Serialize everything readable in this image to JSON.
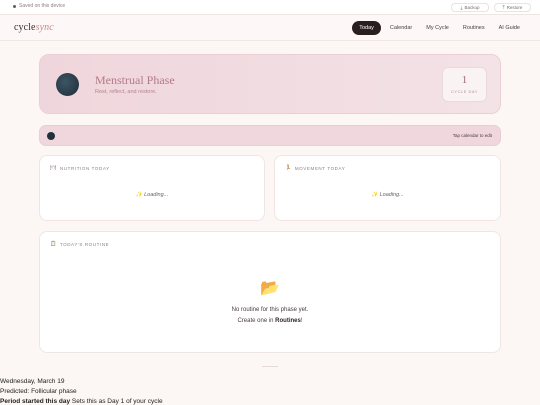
{
  "topbar": {
    "saved_label": "Saved on this device",
    "backup_label": "Backup",
    "restore_label": "Restore"
  },
  "header": {
    "logo_cycle": "cycle",
    "logo_sync": "sync",
    "nav": [
      {
        "label": "Today",
        "active": true
      },
      {
        "label": "Calendar"
      },
      {
        "label": "My Cycle"
      },
      {
        "label": "Routines"
      },
      {
        "label": "AI Guide"
      }
    ]
  },
  "phase": {
    "title": "Menstrual Phase",
    "subtitle": "Rest, reflect, and restore.",
    "cycle_day": "1",
    "cycle_day_label": "CYCLE DAY"
  },
  "strip": {
    "hint": "Tap calendar to edit"
  },
  "nutrition": {
    "icon": "🍽",
    "title": "NUTRITION TODAY",
    "status": "✨ Loading..."
  },
  "movement": {
    "icon": "🏃",
    "title": "MOVEMENT TODAY",
    "status": "✨ Loading..."
  },
  "routine": {
    "icon": "📋",
    "title": "TODAY'S ROUTINE",
    "folder_icon": "📂",
    "empty_line1": "No routine for this phase yet.",
    "empty_line2_prefix": "Create one in ",
    "empty_line2_link": "Routines",
    "empty_line2_suffix": "!"
  },
  "footer": {
    "date": "Wednesday, March 19",
    "predicted": "Predicted: Follicular phase",
    "action_bold": "Period started this day",
    "action_rest": " Sets this as Day 1 of your cycle"
  },
  "colors": {
    "accent_dark": "#2a1f1f",
    "phase_pink": "#efd6dc",
    "phase_text": "#b37a86"
  }
}
